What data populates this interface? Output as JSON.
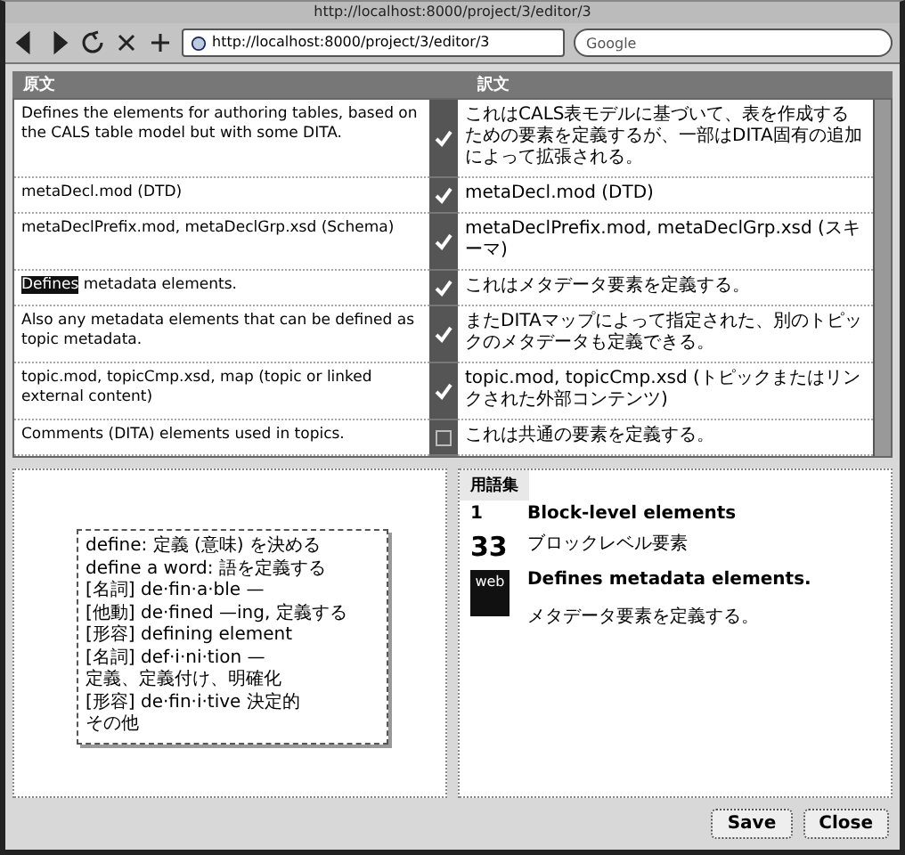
{
  "window": {
    "title": "http://localhost:8000/project/3/editor/3"
  },
  "toolbar": {
    "url": "http://localhost:8000/project/3/editor/3",
    "search_placeholder": "Google"
  },
  "source_panel": {
    "title": "原文"
  },
  "target_panel": {
    "title": "訳文"
  },
  "segments": [
    {
      "source": [
        {
          "text": "Defines the elements for authoring tables, based on the CALS table model but with some DITA.",
          "highlighted": false
        }
      ],
      "target": "これはCALS表モデルに基づいて、表を作成するための要素を定義するが、一部はDITA固有の追加によって拡張される。",
      "confirmed": true
    },
    {
      "source": [
        {
          "text": "metaDecl.mod (DTD)",
          "highlighted": false
        }
      ],
      "target": "metaDecl.mod (DTD)",
      "confirmed": true
    },
    {
      "source": [
        {
          "text": "metaDeclPrefix.mod, metaDeclGrp.xsd (Schema)",
          "highlighted": false
        }
      ],
      "target": "metaDeclPrefix.mod, metaDeclGrp.xsd (スキーマ)",
      "confirmed": true
    },
    {
      "source": [
        {
          "text": "Defines",
          "highlighted": true
        },
        {
          "text": " metadata elements.",
          "highlighted": false
        }
      ],
      "target": "これはメタデータ要素を定義する。",
      "confirmed": true
    },
    {
      "source": [
        {
          "text": "Also any metadata elements that can be defined as topic metadata.",
          "highlighted": false
        }
      ],
      "target": "またDITAマップによって指定された、別のトピックのメタデータも定義できる。",
      "confirmed": true
    },
    {
      "source": [
        {
          "text": "topic.mod, topicCmp.xsd, map (topic or linked external content)",
          "highlighted": false
        }
      ],
      "target": "topic.mod, topicCmp.xsd (トピックまたはリンクされた外部コンテンツ)",
      "confirmed": true
    },
    {
      "source": [
        {
          "text": "Comments (DITA) elements used in topics.",
          "highlighted": false
        }
      ],
      "target": "これは共通の要素を定義する。",
      "confirmed": false
    }
  ],
  "dictionary_popup": {
    "lines": [
      "define: 定義 (意味) を決める",
      "define a word: 語を定義する",
      "[名詞] de·fin·a·ble —",
      "[他動] de·fined —ing, 定義する",
      "[形容] defining element",
      "[名詞] def·i·ni·tion —",
      "定義、定義付け、明確化",
      "[形容] de·fin·i·tive 決定的",
      "その他"
    ]
  },
  "glossary": {
    "title": "用語集",
    "entries": [
      {
        "kind": "number",
        "marker": "1",
        "text": "Block-level elements"
      },
      {
        "kind": "number",
        "marker": "33",
        "text": "ブロックレベル要素"
      },
      {
        "kind": "badge",
        "marker": "web",
        "text": "Defines metadata elements.",
        "note": "メタデータ要素を定義する。"
      }
    ]
  },
  "buttons": [
    "Save",
    "Close"
  ]
}
